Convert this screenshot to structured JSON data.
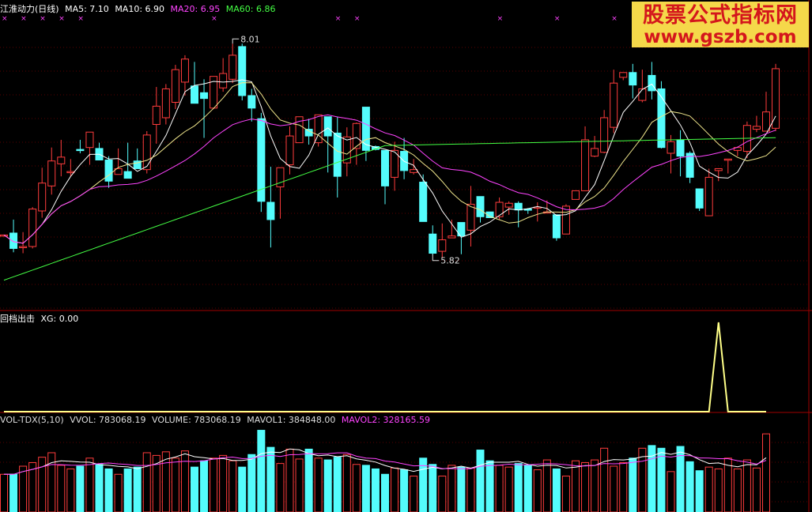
{
  "panels": {
    "main": {
      "stock_name": "江淮动力(日线)",
      "ma_labels": [
        {
          "text": "MA5: 7.10",
          "color": "#ffffff"
        },
        {
          "text": "MA10: 6.90",
          "color": "#ffffff"
        },
        {
          "text": "MA20: 6.95",
          "color": "#ff44ff"
        },
        {
          "text": "MA60: 6.86",
          "color": "#44ff44"
        }
      ],
      "high_label": "8.01",
      "low_label": "5.82"
    },
    "indicator": {
      "title": "回档出击",
      "xg_label": "XG: 0.00"
    },
    "volume": {
      "labels": [
        {
          "text": "VOL-TDX(5,10)",
          "color": "#dddddd"
        },
        {
          "text": "VVOL: 783068.19",
          "color": "#dddddd"
        },
        {
          "text": "VOLUME: 783068.19",
          "color": "#dddddd"
        },
        {
          "text": "MAVOL1: 384848.00",
          "color": "#dddddd"
        },
        {
          "text": "MAVOL2: 328165.59",
          "color": "#ff44ff"
        }
      ]
    }
  },
  "watermark": {
    "text_cn": "股票公式指标网",
    "text_url": "www.gszb.com"
  },
  "colors": {
    "up": "#ff3c3c",
    "down": "#54fcfc",
    "ma5": "#ffffff",
    "ma10": "#f0e68c",
    "ma20": "#ff44ff",
    "ma60": "#44ff44",
    "signal": "#ffff88",
    "grid": "#5a0000",
    "divider": "#a00000",
    "marker": "#ff44ff"
  },
  "chart_data": {
    "type": "candlestick",
    "price_ylim": [
      5.3,
      8.3
    ],
    "candles": [
      {
        "o": 6.01,
        "h": 6.01,
        "l": 6.02,
        "c": 6.02
      },
      {
        "o": 6.04,
        "h": 6.18,
        "l": 5.84,
        "c": 5.88
      },
      {
        "o": 5.89,
        "h": 6.05,
        "l": 5.83,
        "c": 5.9
      },
      {
        "o": 5.9,
        "h": 6.31,
        "l": 5.88,
        "c": 6.29
      },
      {
        "o": 6.27,
        "h": 6.72,
        "l": 6.2,
        "c": 6.56
      },
      {
        "o": 6.53,
        "h": 6.93,
        "l": 6.44,
        "c": 6.79
      },
      {
        "o": 6.76,
        "h": 7.01,
        "l": 6.63,
        "c": 6.83
      },
      {
        "o": 6.67,
        "h": 6.81,
        "l": 6.63,
        "c": 6.68
      },
      {
        "o": 6.91,
        "h": 7.01,
        "l": 6.87,
        "c": 6.9
      },
      {
        "o": 6.93,
        "h": 7.0,
        "l": 6.75,
        "c": 7.09
      },
      {
        "o": 6.92,
        "h": 6.98,
        "l": 6.8,
        "c": 6.8
      },
      {
        "o": 6.8,
        "h": 6.84,
        "l": 6.51,
        "c": 6.58
      },
      {
        "o": 6.65,
        "h": 6.92,
        "l": 6.66,
        "c": 6.71
      },
      {
        "o": 6.68,
        "h": 6.98,
        "l": 6.63,
        "c": 6.61
      },
      {
        "o": 6.79,
        "h": 6.92,
        "l": 6.81,
        "c": 6.71
      },
      {
        "o": 6.7,
        "h": 7.1,
        "l": 6.66,
        "c": 7.06
      },
      {
        "o": 7.17,
        "h": 7.56,
        "l": 6.97,
        "c": 7.36
      },
      {
        "o": 7.24,
        "h": 7.59,
        "l": 7.17,
        "c": 7.54
      },
      {
        "o": 7.4,
        "h": 7.79,
        "l": 7.33,
        "c": 7.74
      },
      {
        "o": 7.61,
        "h": 7.89,
        "l": 7.47,
        "c": 7.85
      },
      {
        "o": 7.57,
        "h": 7.82,
        "l": 7.53,
        "c": 7.39
      },
      {
        "o": 7.5,
        "h": 7.64,
        "l": 7.03,
        "c": 7.44
      },
      {
        "o": 7.34,
        "h": 7.66,
        "l": 7.33,
        "c": 7.67
      },
      {
        "o": 7.55,
        "h": 7.86,
        "l": 7.51,
        "c": 7.7
      },
      {
        "o": 7.64,
        "h": 8.01,
        "l": 7.6,
        "c": 7.89
      },
      {
        "o": 7.98,
        "h": 8.01,
        "l": 7.42,
        "c": 7.47
      },
      {
        "o": 7.47,
        "h": 7.54,
        "l": 7.2,
        "c": 7.34
      },
      {
        "o": 7.23,
        "h": 7.29,
        "l": 6.26,
        "c": 6.37
      },
      {
        "o": 6.36,
        "h": 6.73,
        "l": 5.89,
        "c": 6.18
      },
      {
        "o": 6.52,
        "h": 6.68,
        "l": 6.19,
        "c": 6.72
      },
      {
        "o": 6.75,
        "h": 7.15,
        "l": 6.65,
        "c": 7.05
      },
      {
        "o": 6.98,
        "h": 7.19,
        "l": 6.99,
        "c": 7.25
      },
      {
        "o": 7.12,
        "h": 7.23,
        "l": 6.96,
        "c": 7.05
      },
      {
        "o": 6.98,
        "h": 7.25,
        "l": 6.94,
        "c": 7.27
      },
      {
        "o": 7.25,
        "h": 7.23,
        "l": 6.67,
        "c": 7.05
      },
      {
        "o": 7.08,
        "h": 7.25,
        "l": 6.41,
        "c": 6.63
      },
      {
        "o": 6.77,
        "h": 7.14,
        "l": 6.63,
        "c": 7.04
      },
      {
        "o": 6.92,
        "h": 7.19,
        "l": 6.75,
        "c": 7.18
      },
      {
        "o": 7.35,
        "h": 7.31,
        "l": 6.79,
        "c": 6.9
      },
      {
        "o": 6.94,
        "h": 6.95,
        "l": 6.9,
        "c": 6.91
      },
      {
        "o": 6.9,
        "h": 6.86,
        "l": 6.34,
        "c": 6.53
      },
      {
        "o": 6.62,
        "h": 6.99,
        "l": 6.48,
        "c": 6.9
      },
      {
        "o": 6.89,
        "h": 7.03,
        "l": 6.6,
        "c": 6.69
      },
      {
        "o": 6.67,
        "h": 6.81,
        "l": 6.65,
        "c": 6.7
      },
      {
        "o": 6.57,
        "h": 6.65,
        "l": 6.16,
        "c": 6.16
      },
      {
        "o": 6.03,
        "h": 6.12,
        "l": 5.81,
        "c": 5.83
      },
      {
        "o": 5.85,
        "h": 6.14,
        "l": 5.78,
        "c": 5.97
      },
      {
        "o": 5.99,
        "h": 6.18,
        "l": 6.05,
        "c": 6.01
      },
      {
        "o": 6.15,
        "h": 6.15,
        "l": 5.82,
        "c": 6.01
      },
      {
        "o": 6.07,
        "h": 6.53,
        "l": 5.9,
        "c": 6.34
      },
      {
        "o": 6.42,
        "h": 6.42,
        "l": 6.15,
        "c": 6.21
      },
      {
        "o": 6.26,
        "h": 6.26,
        "l": 6.22,
        "c": 6.2
      },
      {
        "o": 6.21,
        "h": 6.41,
        "l": 6.18,
        "c": 6.36
      },
      {
        "o": 6.31,
        "h": 6.37,
        "l": 6.23,
        "c": 6.35
      },
      {
        "o": 6.35,
        "h": 6.37,
        "l": 6.1,
        "c": 6.28
      },
      {
        "o": 6.29,
        "h": 6.3,
        "l": 6.24,
        "c": 6.28
      },
      {
        "o": 6.31,
        "h": 6.36,
        "l": 6.16,
        "c": 6.31
      },
      {
        "o": 6.26,
        "h": 6.38,
        "l": 6.25,
        "c": 6.26
      },
      {
        "o": 6.23,
        "h": 6.23,
        "l": 5.96,
        "c": 5.99
      },
      {
        "o": 6.03,
        "h": 6.34,
        "l": 6.05,
        "c": 6.32
      },
      {
        "o": 6.39,
        "h": 6.47,
        "l": 6.44,
        "c": 6.48
      },
      {
        "o": 6.48,
        "h": 7.15,
        "l": 6.61,
        "c": 7.01
      },
      {
        "o": 6.84,
        "h": 7.05,
        "l": 6.83,
        "c": 6.92
      },
      {
        "o": 6.88,
        "h": 7.32,
        "l": 6.87,
        "c": 7.24
      },
      {
        "o": 7.14,
        "h": 7.74,
        "l": 7.08,
        "c": 7.6
      },
      {
        "o": 7.66,
        "h": 7.69,
        "l": 7.63,
        "c": 7.71
      },
      {
        "o": 7.71,
        "h": 7.8,
        "l": 7.44,
        "c": 7.58
      },
      {
        "o": 7.42,
        "h": 7.74,
        "l": 7.4,
        "c": 7.54
      },
      {
        "o": 7.68,
        "h": 7.82,
        "l": 7.43,
        "c": 7.52
      },
      {
        "o": 7.54,
        "h": 7.62,
        "l": 6.92,
        "c": 6.93
      },
      {
        "o": 6.87,
        "h": 7.06,
        "l": 6.66,
        "c": 6.99
      },
      {
        "o": 7.01,
        "h": 7.11,
        "l": 6.63,
        "c": 6.84
      },
      {
        "o": 6.87,
        "h": 6.89,
        "l": 6.56,
        "c": 6.62
      },
      {
        "o": 6.5,
        "h": 6.5,
        "l": 6.27,
        "c": 6.3
      },
      {
        "o": 6.22,
        "h": 6.71,
        "l": 6.23,
        "c": 6.62
      },
      {
        "o": 6.69,
        "h": 6.71,
        "l": 6.58,
        "c": 6.71
      },
      {
        "o": 6.8,
        "h": 6.72,
        "l": 6.66,
        "c": 6.81
      },
      {
        "o": 6.9,
        "h": 6.94,
        "l": 6.84,
        "c": 6.93
      },
      {
        "o": 6.89,
        "h": 7.2,
        "l": 6.82,
        "c": 7.16
      },
      {
        "o": 7.12,
        "h": 7.26,
        "l": 7.09,
        "c": 7.15
      },
      {
        "o": 7.1,
        "h": 7.51,
        "l": 7.19,
        "c": 7.3
      },
      {
        "o": 7.13,
        "h": 7.8,
        "l": 7.1,
        "c": 7.75
      }
    ],
    "indicator": {
      "name": "XG",
      "values": [
        0,
        0,
        0,
        0,
        0,
        0,
        0,
        0,
        0,
        0,
        0,
        0,
        0,
        0,
        0,
        0,
        0,
        0,
        0,
        0,
        0,
        0,
        0,
        0,
        0,
        0,
        0,
        0,
        0,
        0,
        0,
        0,
        0,
        0,
        0,
        0,
        0,
        0,
        0,
        0,
        0,
        0,
        0,
        0,
        0,
        0,
        0,
        0,
        0,
        0,
        0,
        0,
        0,
        0,
        0,
        0,
        0,
        0,
        0,
        0,
        0,
        0,
        0,
        0,
        0,
        0,
        0,
        0,
        0,
        0,
        0,
        0,
        0,
        0,
        0,
        1,
        0,
        0,
        0,
        0,
        0
      ]
    },
    "volume": {
      "values": [
        42,
        42,
        51,
        55,
        61,
        66,
        52,
        48,
        51,
        60,
        53,
        48,
        42,
        48,
        50,
        66,
        63,
        67,
        60,
        68,
        50,
        57,
        60,
        63,
        57,
        50,
        64,
        91,
        72,
        54,
        70,
        59,
        70,
        60,
        58,
        61,
        64,
        53,
        52,
        48,
        42,
        49,
        47,
        40,
        60,
        53,
        40,
        52,
        50,
        49,
        69,
        57,
        52,
        50,
        54,
        52,
        47,
        58,
        48,
        40,
        57,
        55,
        58,
        71,
        51,
        55,
        60,
        71,
        74,
        71,
        45,
        73,
        56,
        46,
        50,
        48,
        60,
        48,
        58,
        49,
        87
      ]
    },
    "markers_x_indices": [
      0,
      1,
      2,
      3,
      4,
      5,
      6,
      7,
      8,
      9,
      10,
      11,
      12,
      13,
      14,
      15,
      16,
      17,
      18,
      19,
      20,
      21,
      22,
      23,
      24,
      25,
      26,
      27,
      28,
      29,
      30,
      31,
      32,
      33,
      34,
      35,
      36,
      37,
      38,
      39,
      40,
      41,
      42,
      43,
      44,
      45,
      46,
      47,
      48,
      49,
      50,
      51,
      52,
      53,
      54,
      55,
      56,
      57,
      58,
      59,
      60,
      61,
      62,
      63,
      64,
      65,
      66,
      67,
      68,
      69,
      70,
      71,
      72,
      73,
      74,
      75,
      76,
      77,
      78,
      79,
      80
    ]
  }
}
